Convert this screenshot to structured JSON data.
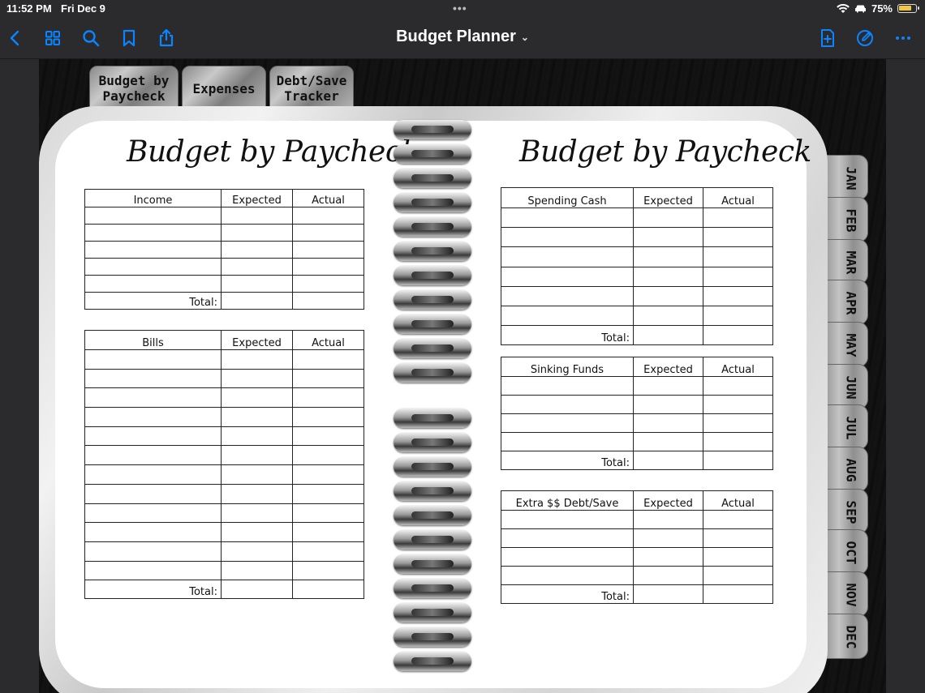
{
  "status_bar": {
    "time": "11:52 PM",
    "date": "Fri Dec 9",
    "battery": "75%",
    "battery_level": 0.75
  },
  "toolbar": {
    "title": "Budget Planner",
    "icons": [
      "back-chevron-icon",
      "grid-icon",
      "search-icon",
      "bookmark-icon",
      "share-icon",
      "add-page-icon",
      "pencil-icon",
      "more-icon"
    ],
    "accent_color": "#0a84ff"
  },
  "top_tabs": [
    {
      "label": "Budget by\nPaycheck"
    },
    {
      "label": "Expenses"
    },
    {
      "label": "Debt/Save\nTracker"
    }
  ],
  "months": [
    "JAN",
    "FEB",
    "MAR",
    "APR",
    "MAY",
    "JUN",
    "JUL",
    "AUG",
    "SEP",
    "OCT",
    "NOV",
    "DEC"
  ],
  "left_page": {
    "title": "Budget by Paycheck",
    "income": {
      "header": "Income",
      "col_expected": "Expected",
      "col_actual": "Actual",
      "total_label": "Total:",
      "rows": 5
    },
    "bills": {
      "header": "Bills",
      "col_expected": "Expected",
      "col_actual": "Actual",
      "total_label": "Total:",
      "rows": 12
    }
  },
  "right_page": {
    "title": "Budget by Paycheck",
    "spending": {
      "header": "Spending Cash",
      "col_expected": "Expected",
      "col_actual": "Actual",
      "total_label": "Total:",
      "rows": 6
    },
    "sinking": {
      "header": "Sinking Funds",
      "col_expected": "Expected",
      "col_actual": "Actual",
      "total_label": "Total:",
      "rows": 4
    },
    "extra": {
      "header": "Extra $$ Debt/Save",
      "col_expected": "Expected",
      "col_actual": "Actual",
      "total_label": "Total:",
      "rows": 4
    }
  }
}
